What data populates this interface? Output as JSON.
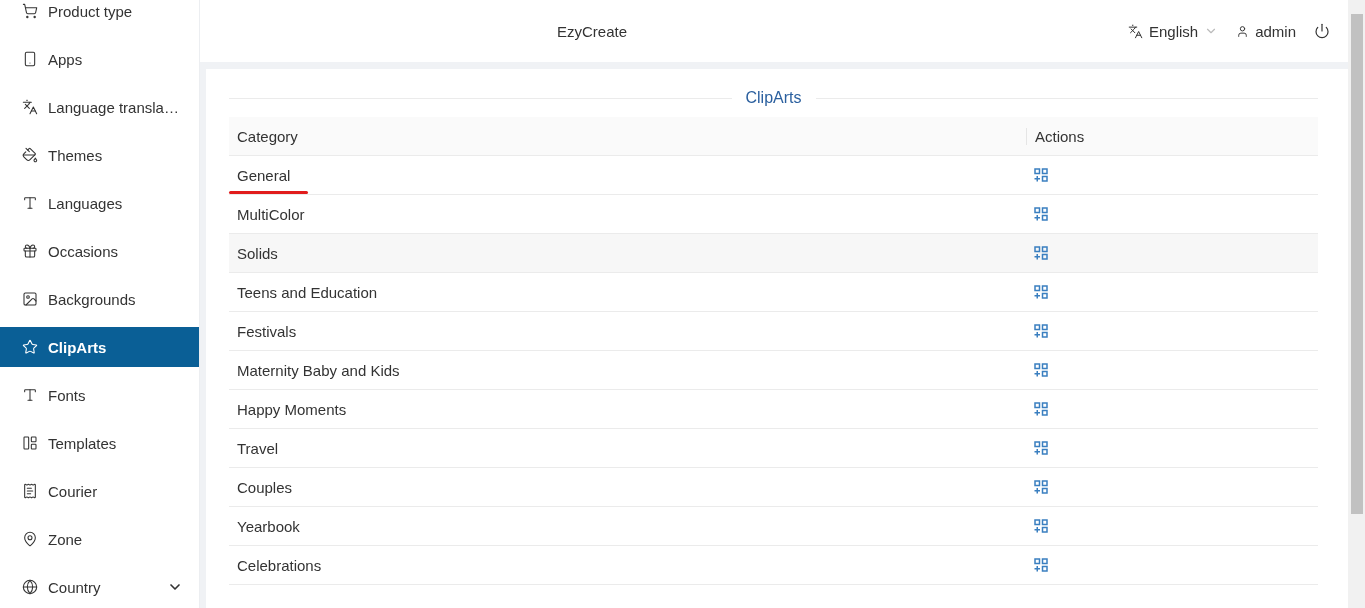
{
  "sidebar": {
    "items": [
      {
        "label": "Product type",
        "selected": false
      },
      {
        "label": "Apps",
        "selected": false
      },
      {
        "label": "Language transla…",
        "selected": false
      },
      {
        "label": "Themes",
        "selected": false
      },
      {
        "label": "Languages",
        "selected": false
      },
      {
        "label": "Occasions",
        "selected": false
      },
      {
        "label": "Backgrounds",
        "selected": false
      },
      {
        "label": "ClipArts",
        "selected": true
      },
      {
        "label": "Fonts",
        "selected": false
      },
      {
        "label": "Templates",
        "selected": false
      },
      {
        "label": "Courier",
        "selected": false
      },
      {
        "label": "Zone",
        "selected": false
      },
      {
        "label": "Country",
        "selected": false,
        "expandable": true
      }
    ]
  },
  "header": {
    "brand": "EzyCreate",
    "language": "English",
    "user": "admin"
  },
  "page": {
    "title": "ClipArts",
    "table": {
      "columns": [
        "Category",
        "Actions"
      ],
      "rows": [
        {
          "category": "General",
          "underlined": true,
          "hovered": false
        },
        {
          "category": "MultiColor",
          "underlined": false,
          "hovered": false
        },
        {
          "category": "Solids",
          "underlined": false,
          "hovered": true
        },
        {
          "category": "Teens and Education",
          "underlined": false,
          "hovered": false
        },
        {
          "category": "Festivals",
          "underlined": false,
          "hovered": false
        },
        {
          "category": "Maternity Baby and Kids",
          "underlined": false,
          "hovered": false
        },
        {
          "category": "Happy Moments",
          "underlined": false,
          "hovered": false
        },
        {
          "category": "Travel",
          "underlined": false,
          "hovered": false
        },
        {
          "category": "Couples",
          "underlined": false,
          "hovered": false
        },
        {
          "category": "Yearbook",
          "underlined": false,
          "hovered": false
        },
        {
          "category": "Celebrations",
          "underlined": false,
          "hovered": false
        }
      ]
    }
  }
}
